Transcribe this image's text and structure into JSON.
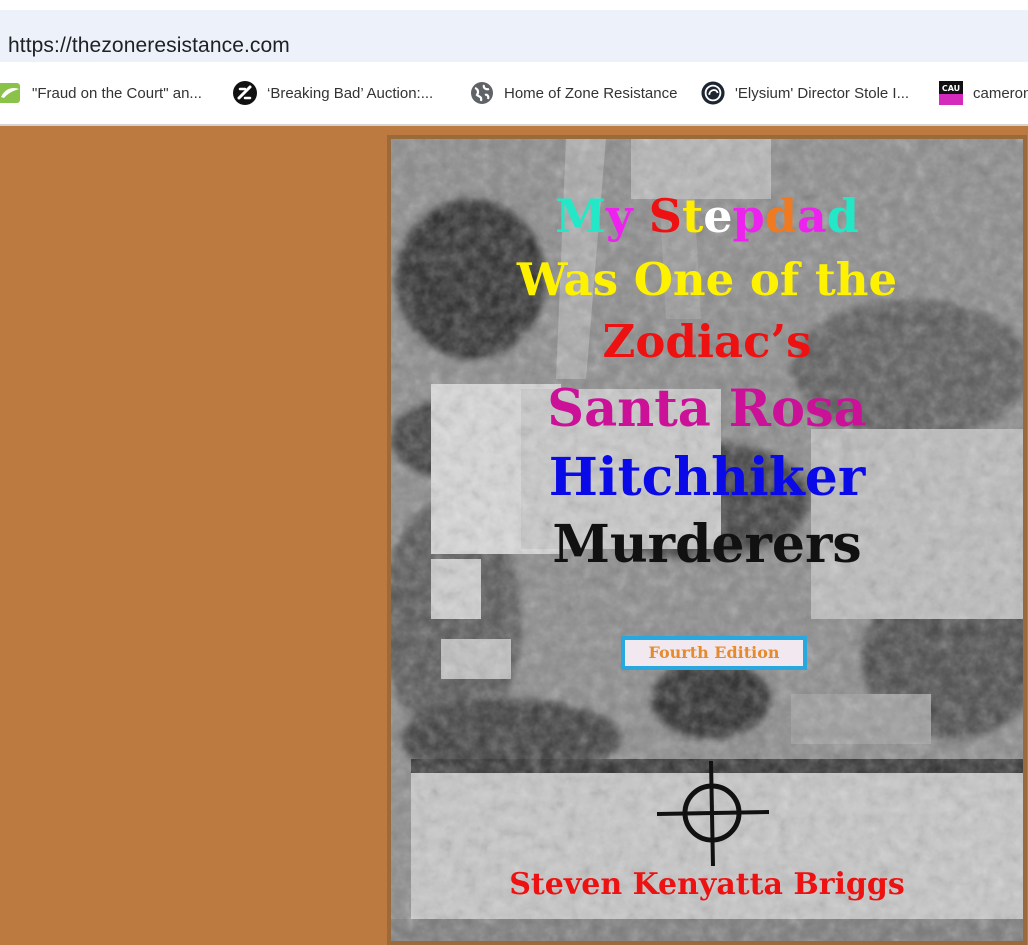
{
  "browser": {
    "url": "https://thezoneresistance.com",
    "bookmarks": [
      {
        "label": "\"Fraud on the Court\" an...",
        "icon": "leaf-icon"
      },
      {
        "label": "‘Breaking Bad’ Auction:...",
        "icon": "slash-circle-icon"
      },
      {
        "label": "Home of Zone Resistance",
        "icon": "globe-icon"
      },
      {
        "label": "'Elysium' Director Stole I...",
        "icon": "swirl-icon"
      },
      {
        "label": "cameron",
        "icon": "cau-icon"
      }
    ]
  },
  "colors": {
    "page_background": "#bc7a40",
    "cover_border": "#9b6a3b",
    "edition_border": "#29a7df",
    "author": "#ee1111"
  },
  "cover": {
    "title_line1_letters": [
      {
        "ch": "M",
        "color": "#22e8c8"
      },
      {
        "ch": "y",
        "color": "#ee22ee"
      },
      {
        "ch": " ",
        "color": "#ffffff"
      },
      {
        "ch": "S",
        "color": "#ee1111"
      },
      {
        "ch": "t",
        "color": "#ffee00"
      },
      {
        "ch": "e",
        "color": "#ffffff"
      },
      {
        "ch": "p",
        "color": "#ee22ee"
      },
      {
        "ch": "d",
        "color": "#f07a22"
      },
      {
        "ch": "a",
        "color": "#ee22ee"
      },
      {
        "ch": "d",
        "color": "#22e8c8"
      }
    ],
    "title_line2": "Was One of the",
    "title_line3": "Zodiac’s",
    "title_line4": "Santa Rosa",
    "title_line5": "Hitchhiker",
    "title_line6": "Murderers",
    "title_colors": {
      "line2": "#fff200",
      "line3": "#ee1111",
      "line4": "#cc1199",
      "line5": "#0a0ae8",
      "line6": "#111111"
    },
    "edition": "Fourth Edition",
    "author": "Steven Kenyatta Briggs",
    "emblem": "crosshair-icon"
  }
}
